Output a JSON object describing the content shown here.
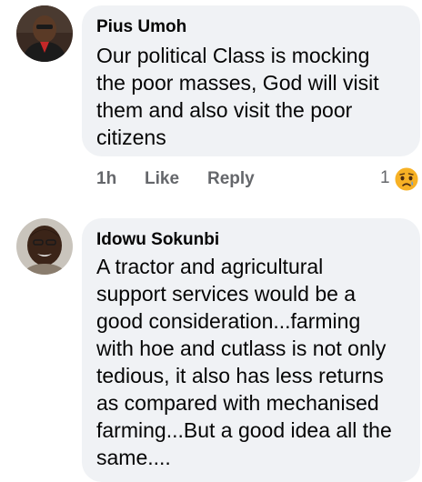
{
  "comments": [
    {
      "author": "Pius Umoh",
      "text": "Our political Class is mocking\nthe poor masses, God will visit\nthem and also visit the poor\ncitizens",
      "time": "1h",
      "like_label": "Like",
      "reply_label": "Reply",
      "reaction_count": "1",
      "reaction_icon": "sad-face-icon"
    },
    {
      "author": "Idowu Sokunbi",
      "text": "A tractor and agricultural\nsupport services would be a\ngood consideration...farming\nwith hoe and cutlass is not only\ntedious, it also has less returns\nas compared with mechanised\nfarming...But a good idea all the\nsame...."
    }
  ],
  "colors": {
    "bubble_bg": "#f0f2f5",
    "secondary_text": "#65676b",
    "reaction_yellow": "#f7b125"
  }
}
